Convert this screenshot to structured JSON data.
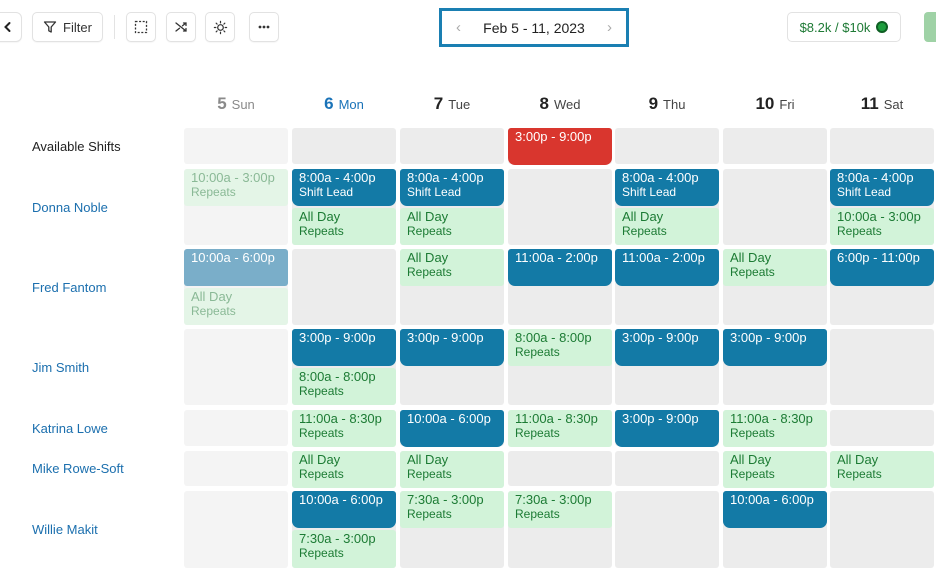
{
  "toolbar": {
    "filter_label": "Filter",
    "date_range": "Feb 5 - 11, 2023",
    "budget_text": "$8.2k / $10k",
    "colors": {
      "nav_border": "#1a7fb2",
      "budget_text": "#1e7a35",
      "budget_dot": "#1e9e3e"
    }
  },
  "days": [
    {
      "num": "5",
      "name": "Sun",
      "state": "past"
    },
    {
      "num": "6",
      "name": "Mon",
      "state": "today"
    },
    {
      "num": "7",
      "name": "Tue",
      "state": "normal"
    },
    {
      "num": "8",
      "name": "Wed",
      "state": "normal"
    },
    {
      "num": "9",
      "name": "Thu",
      "state": "normal"
    },
    {
      "num": "10",
      "name": "Fri",
      "state": "normal"
    },
    {
      "num": "11",
      "name": "Sat",
      "state": "normal"
    }
  ],
  "rows": [
    {
      "name": "Available Shifts",
      "kind": "available",
      "shifts": [
        {
          "day": 3,
          "slot": 0,
          "time": "3:00p - 9:00p",
          "kind": "red"
        }
      ]
    },
    {
      "name": "Donna Noble",
      "shifts": [
        {
          "day": 0,
          "slot": 0,
          "time": "10:00a - 3:00p",
          "sub": "Repeats",
          "kind": "greenfade"
        },
        {
          "day": 1,
          "slot": 0,
          "time": "8:00a - 4:00p",
          "sub": "Shift Lead",
          "kind": "blue"
        },
        {
          "day": 1,
          "slot": 1,
          "time": "All Day",
          "sub": "Repeats",
          "kind": "green"
        },
        {
          "day": 2,
          "slot": 0,
          "time": "8:00a - 4:00p",
          "sub": "Shift Lead",
          "kind": "blue"
        },
        {
          "day": 2,
          "slot": 1,
          "time": "All Day",
          "sub": "Repeats",
          "kind": "green"
        },
        {
          "day": 4,
          "slot": 0,
          "time": "8:00a - 4:00p",
          "sub": "Shift Lead",
          "kind": "blue"
        },
        {
          "day": 4,
          "slot": 1,
          "time": "All Day",
          "sub": "Repeats",
          "kind": "green"
        },
        {
          "day": 6,
          "slot": 0,
          "time": "8:00a - 4:00p",
          "sub": "Shift Lead",
          "kind": "blue"
        },
        {
          "day": 6,
          "slot": 1,
          "time": "10:00a - 3:00p",
          "sub": "Repeats",
          "kind": "green"
        }
      ]
    },
    {
      "name": "Fred Fantom",
      "shifts": [
        {
          "day": 0,
          "slot": 0,
          "time": "10:00a - 6:00p",
          "kind": "bluefade"
        },
        {
          "day": 0,
          "slot": 1,
          "time": "All Day",
          "sub": "Repeats",
          "kind": "greenfade"
        },
        {
          "day": 2,
          "slot": 0,
          "time": "All Day",
          "sub": "Repeats",
          "kind": "green"
        },
        {
          "day": 3,
          "slot": 0,
          "time": "11:00a - 2:00p",
          "kind": "blue"
        },
        {
          "day": 4,
          "slot": 0,
          "time": "11:00a - 2:00p",
          "kind": "blue"
        },
        {
          "day": 5,
          "slot": 0,
          "time": "All Day",
          "sub": "Repeats",
          "kind": "green"
        },
        {
          "day": 6,
          "slot": 0,
          "time": "6:00p - 11:00p",
          "kind": "blue"
        }
      ]
    },
    {
      "name": "Jim Smith",
      "shifts": [
        {
          "day": 1,
          "slot": 0,
          "time": "3:00p - 9:00p",
          "kind": "blue"
        },
        {
          "day": 1,
          "slot": 1,
          "time": "8:00a - 8:00p",
          "sub": "Repeats",
          "kind": "green"
        },
        {
          "day": 2,
          "slot": 0,
          "time": "3:00p - 9:00p",
          "kind": "blue"
        },
        {
          "day": 3,
          "slot": 0,
          "time": "8:00a - 8:00p",
          "sub": "Repeats",
          "kind": "green"
        },
        {
          "day": 4,
          "slot": 0,
          "time": "3:00p - 9:00p",
          "kind": "blue"
        },
        {
          "day": 5,
          "slot": 0,
          "time": "3:00p - 9:00p",
          "kind": "blue"
        }
      ]
    },
    {
      "name": "Katrina Lowe",
      "shifts": [
        {
          "day": 1,
          "slot": 0,
          "time": "11:00a - 8:30p",
          "sub": "Repeats",
          "kind": "green"
        },
        {
          "day": 2,
          "slot": 0,
          "time": "10:00a - 6:00p",
          "kind": "blue"
        },
        {
          "day": 3,
          "slot": 0,
          "time": "11:00a - 8:30p",
          "sub": "Repeats",
          "kind": "green"
        },
        {
          "day": 4,
          "slot": 0,
          "time": "3:00p - 9:00p",
          "kind": "blue"
        },
        {
          "day": 5,
          "slot": 0,
          "time": "11:00a - 8:30p",
          "sub": "Repeats",
          "kind": "green"
        }
      ]
    },
    {
      "name": "Mike Rowe-Soft",
      "shifts": [
        {
          "day": 1,
          "slot": 0,
          "time": "All Day",
          "sub": "Repeats",
          "kind": "green"
        },
        {
          "day": 2,
          "slot": 0,
          "time": "All Day",
          "sub": "Repeats",
          "kind": "green"
        },
        {
          "day": 5,
          "slot": 0,
          "time": "All Day",
          "sub": "Repeats",
          "kind": "green"
        },
        {
          "day": 6,
          "slot": 0,
          "time": "All Day",
          "sub": "Repeats",
          "kind": "green"
        }
      ]
    },
    {
      "name": "Willie Makit",
      "shifts": [
        {
          "day": 1,
          "slot": 0,
          "time": "10:00a - 6:00p",
          "kind": "blue"
        },
        {
          "day": 1,
          "slot": 1,
          "time": "7:30a - 3:00p",
          "sub": "Repeats",
          "kind": "green"
        },
        {
          "day": 2,
          "slot": 0,
          "time": "7:30a - 3:00p",
          "sub": "Repeats",
          "kind": "green"
        },
        {
          "day": 3,
          "slot": 0,
          "time": "7:30a - 3:00p",
          "sub": "Repeats",
          "kind": "green"
        },
        {
          "day": 5,
          "slot": 0,
          "time": "10:00a - 6:00p",
          "kind": "blue"
        }
      ]
    }
  ]
}
